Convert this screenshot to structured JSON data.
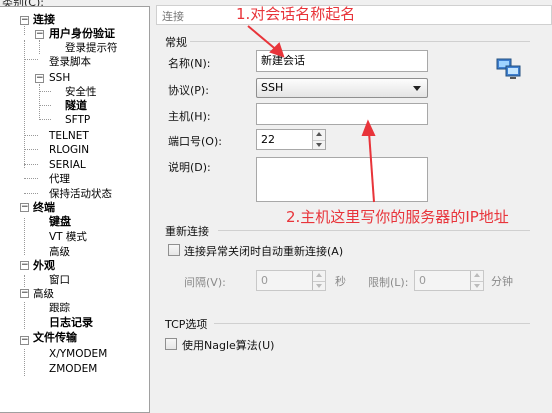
{
  "category_caption": "类别(C):",
  "tree": {
    "connection": "连接",
    "user_auth": "用户身份验证",
    "login_prompt": "登录提示符",
    "login_script": "登录脚本",
    "ssh": "SSH",
    "security": "安全性",
    "tunnel": "隧道",
    "sftp": "SFTP",
    "telnet": "TELNET",
    "rlogin": "RLOGIN",
    "serial": "SERIAL",
    "proxy": "代理",
    "keepalive": "保持活动状态",
    "terminal": "终端",
    "keyboard": "键盘",
    "vt_mode": "VT 模式",
    "advanced": "高级",
    "appearance": "外观",
    "window": "窗口",
    "advanced2": "高级",
    "trace": "跟踪",
    "logging": "日志记录",
    "file_transfer": "文件传输",
    "xymodem": "X/YMODEM",
    "zmodem": "ZMODEM"
  },
  "panel": {
    "header": "连接",
    "general_section": "常规",
    "name_label": "名称(N):",
    "name_value": "新建会话",
    "protocol_label": "协议(P):",
    "protocol_value": "SSH",
    "host_label": "主机(H):",
    "host_value": "",
    "port_label": "端口号(O):",
    "port_value": "22",
    "desc_label": "说明(D):",
    "desc_value": "",
    "reconnect_section": "重新连接",
    "reconnect_checkbox": "连接异常关闭时自动重新连接(A)",
    "interval_label": "间隔(V):",
    "interval_value": "0",
    "interval_unit": "秒",
    "limit_label": "限制(L):",
    "limit_value": "0",
    "limit_unit": "分钟",
    "tcp_section": "TCP选项",
    "nagle_checkbox": "使用Nagle算法(U)"
  },
  "annotations": {
    "a1": "1.对会话名称起名",
    "a2": "2.主机这里写你的服务器的IP地址"
  },
  "colors": {
    "annotation": "#e8343a",
    "tree_bg": "#ffffff",
    "dialog_bg": "#f0f0f0"
  },
  "icons": {
    "network": "computers-network-icon"
  }
}
